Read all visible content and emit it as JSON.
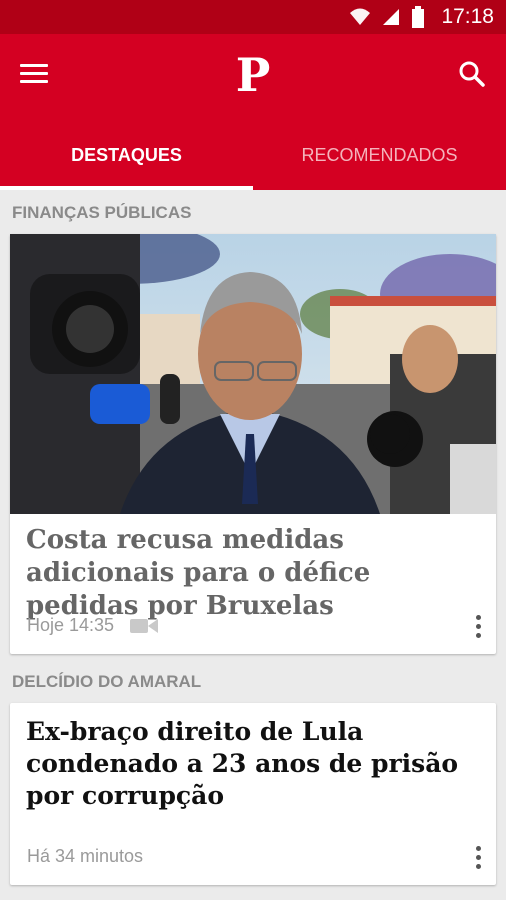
{
  "status": {
    "time": "17:18"
  },
  "header": {
    "logo": "P"
  },
  "tabs": [
    {
      "label": "DESTAQUES"
    },
    {
      "label": "RECOMENDADOS"
    }
  ],
  "articles": [
    {
      "section": "FINANÇAS PÚBLICAS",
      "title": "Costa recusa medidas adicionais para o défice pedidas por Bruxelas",
      "time": "Hoje 14:35",
      "has_video": true
    },
    {
      "section": "DELCÍDIO DO AMARAL",
      "title": "Ex-braço direito de Lula condenado a 23 anos de prisão por corrupção",
      "time": "Há 34 minutos"
    }
  ],
  "colors": {
    "status_bar": "#b00016",
    "app_bar": "#d40022",
    "inactive_tab": "#f4b3bc"
  }
}
